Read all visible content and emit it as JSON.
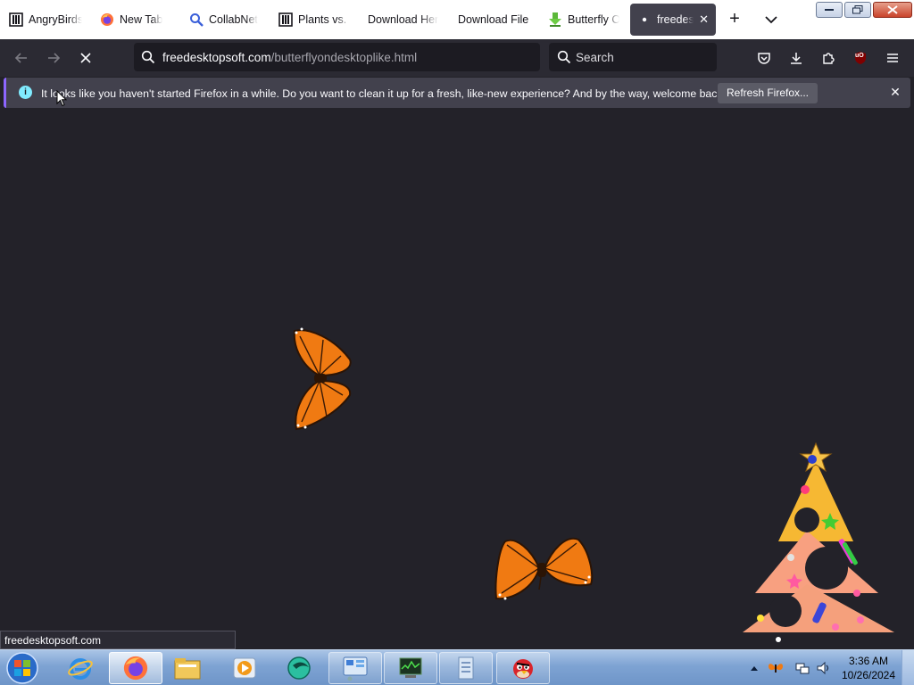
{
  "tabs": [
    {
      "title": "AngryBirds",
      "icon": "columns-icon"
    },
    {
      "title": "New Tab",
      "icon": "firefox-icon"
    },
    {
      "title": "CollabNet",
      "icon": "magnifier-icon"
    },
    {
      "title": "Plants vs. Z",
      "icon": "columns-icon"
    },
    {
      "title": "Download Her",
      "icon": "none"
    },
    {
      "title": "Download File",
      "icon": "none"
    },
    {
      "title": "Butterfly O",
      "icon": "download-arrow-icon"
    },
    {
      "title": "freedesk",
      "icon": "loading-dot-icon"
    }
  ],
  "navbar": {
    "url_host": "freedesktopsoft.com",
    "url_path": "/butterflyondesktoplike.html",
    "search_placeholder": "Search",
    "addon_badge": "uO"
  },
  "notification": {
    "message": "It looks like you haven't started Firefox in a while. Do you want to clean it up for a fresh, like-new experience? And by the way, welcome back!",
    "button_label": "Refresh Firefox..."
  },
  "status_text": "freedesktopsoft.com",
  "taskbar": {
    "time": "3:36 AM",
    "date": "10/26/2024"
  },
  "colors": {
    "accent": "#8d66ff",
    "info": "#80ebff",
    "toolbar": "#2b2a33",
    "content_bg": "#232229"
  }
}
